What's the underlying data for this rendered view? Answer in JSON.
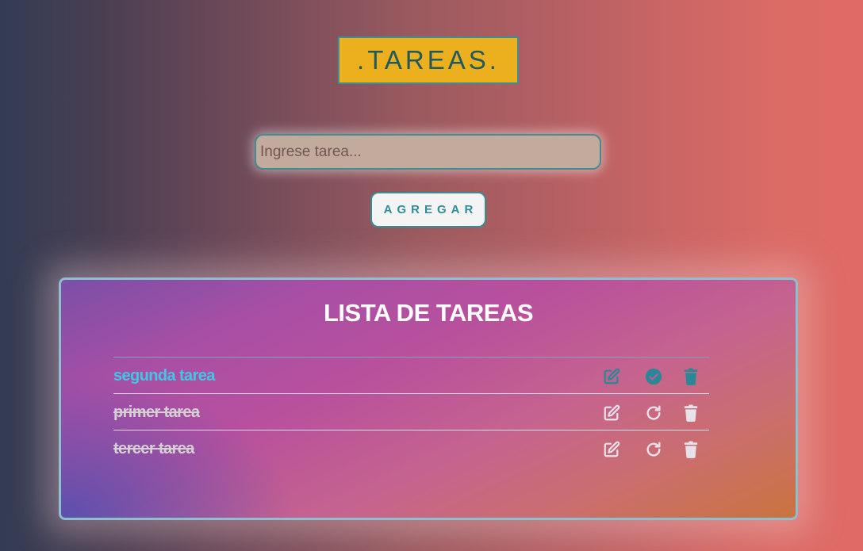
{
  "header": {
    "title": ".TAREAS."
  },
  "form": {
    "placeholder": "Ingrese tarea...",
    "add_label": "AGREGAR"
  },
  "list": {
    "title": "LISTA DE TAREAS",
    "items": [
      {
        "label": "segunda tarea",
        "status": "pending",
        "edit_icon": "edit-icon",
        "action_icon": "check-circle-icon",
        "delete_icon": "trash-icon"
      },
      {
        "label": "primer tarea",
        "status": "done",
        "edit_icon": "edit-icon",
        "action_icon": "redo-icon",
        "delete_icon": "trash-icon"
      },
      {
        "label": "tercer tarea",
        "status": "done",
        "edit_icon": "edit-icon",
        "action_icon": "redo-icon",
        "delete_icon": "trash-icon"
      }
    ]
  },
  "colors": {
    "title_bg": "#ecaf1d",
    "title_text": "#1e5a5e",
    "accent_teal": "#2e8d96",
    "pending_text": "#3fc7e6",
    "done_text": "#d5d0d4",
    "pending_icon": "#2a8896",
    "done_icon": "#e7e2ea"
  }
}
